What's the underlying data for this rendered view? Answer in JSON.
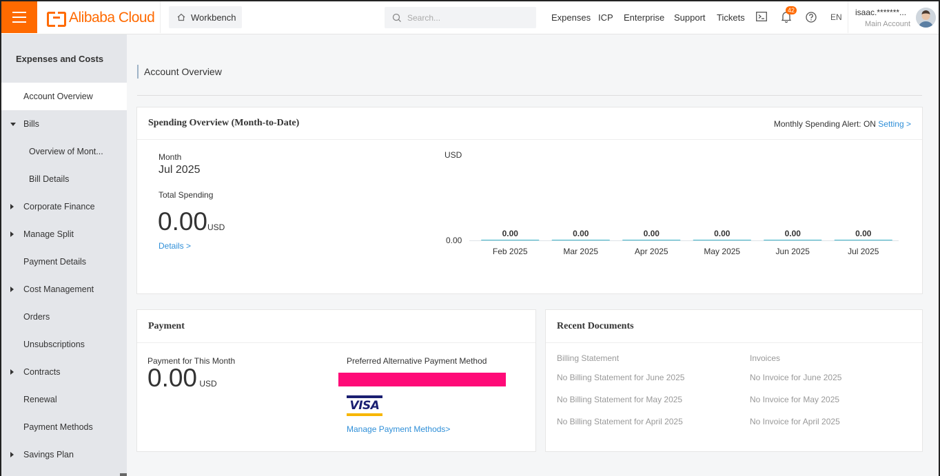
{
  "header": {
    "logo_text": "Alibaba Cloud",
    "workbench_label": "Workbench",
    "search_placeholder": "Search...",
    "nav": [
      "Expenses",
      "ICP",
      "Enterprise",
      "Support",
      "Tickets"
    ],
    "notification_count": "42",
    "language": "EN",
    "user_name": "isaac.*******...",
    "user_role": "Main Account",
    "accent_color": "#ff6a00"
  },
  "sidebar": {
    "title": "Expenses and Costs",
    "items": [
      {
        "label": "Account Overview",
        "level": 0,
        "arrow": "none",
        "active": true
      },
      {
        "label": "Bills",
        "level": 0,
        "arrow": "down",
        "active": false
      },
      {
        "label": "Overview of Mont...",
        "level": 1,
        "arrow": "none",
        "active": false
      },
      {
        "label": "Bill Details",
        "level": 1,
        "arrow": "none",
        "active": false
      },
      {
        "label": "Corporate Finance",
        "level": 0,
        "arrow": "right",
        "active": false
      },
      {
        "label": "Manage Split",
        "level": 0,
        "arrow": "right",
        "active": false
      },
      {
        "label": "Payment Details",
        "level": 0,
        "arrow": "none",
        "active": false
      },
      {
        "label": "Cost Management",
        "level": 0,
        "arrow": "right",
        "active": false
      },
      {
        "label": "Orders",
        "level": 0,
        "arrow": "none",
        "active": false
      },
      {
        "label": "Unsubscriptions",
        "level": 0,
        "arrow": "none",
        "active": false
      },
      {
        "label": "Contracts",
        "level": 0,
        "arrow": "right",
        "active": false
      },
      {
        "label": "Renewal",
        "level": 0,
        "arrow": "none",
        "active": false
      },
      {
        "label": "Payment Methods",
        "level": 0,
        "arrow": "none",
        "active": false
      },
      {
        "label": "Savings Plan",
        "level": 0,
        "arrow": "right",
        "active": false
      }
    ]
  },
  "page": {
    "title": "Account Overview"
  },
  "spending": {
    "heading": "Spending Overview (Month-to-Date)",
    "alert_label": "Monthly Spending Alert: ON",
    "alert_link": "Setting >",
    "month_label": "Month",
    "month_value": "Jul 2025",
    "total_label": "Total Spending",
    "total_value": "0.00",
    "total_unit": "USD",
    "details_link": "Details >"
  },
  "chart_data": {
    "type": "bar",
    "ylabel": "USD",
    "categories": [
      "Feb 2025",
      "Mar 2025",
      "Apr 2025",
      "May 2025",
      "Jun 2025",
      "Jul 2025"
    ],
    "values": [
      0.0,
      0.0,
      0.0,
      0.0,
      0.0,
      0.0
    ],
    "data_labels": [
      "0.00",
      "0.00",
      "0.00",
      "0.00",
      "0.00",
      "0.00"
    ],
    "y_ticks": [
      "0.00"
    ],
    "bar_color": "#3fb6c9"
  },
  "payment": {
    "heading": "Payment",
    "month_label": "Payment for This Month",
    "amount": "0.00",
    "unit": "USD",
    "preferred_label": "Preferred Alternative Payment Method",
    "card_brand": "VISA",
    "manage_link": "Manage Payment Methods>"
  },
  "documents": {
    "heading": "Recent Documents",
    "billing_header": "Billing Statement",
    "invoice_header": "Invoices",
    "billing": [
      "No Billing Statement for June 2025",
      "No Billing Statement for May 2025",
      "No Billing Statement for April 2025"
    ],
    "invoices": [
      "No Invoice for June 2025",
      "No Invoice for May 2025",
      "No Invoice for April 2025"
    ]
  }
}
